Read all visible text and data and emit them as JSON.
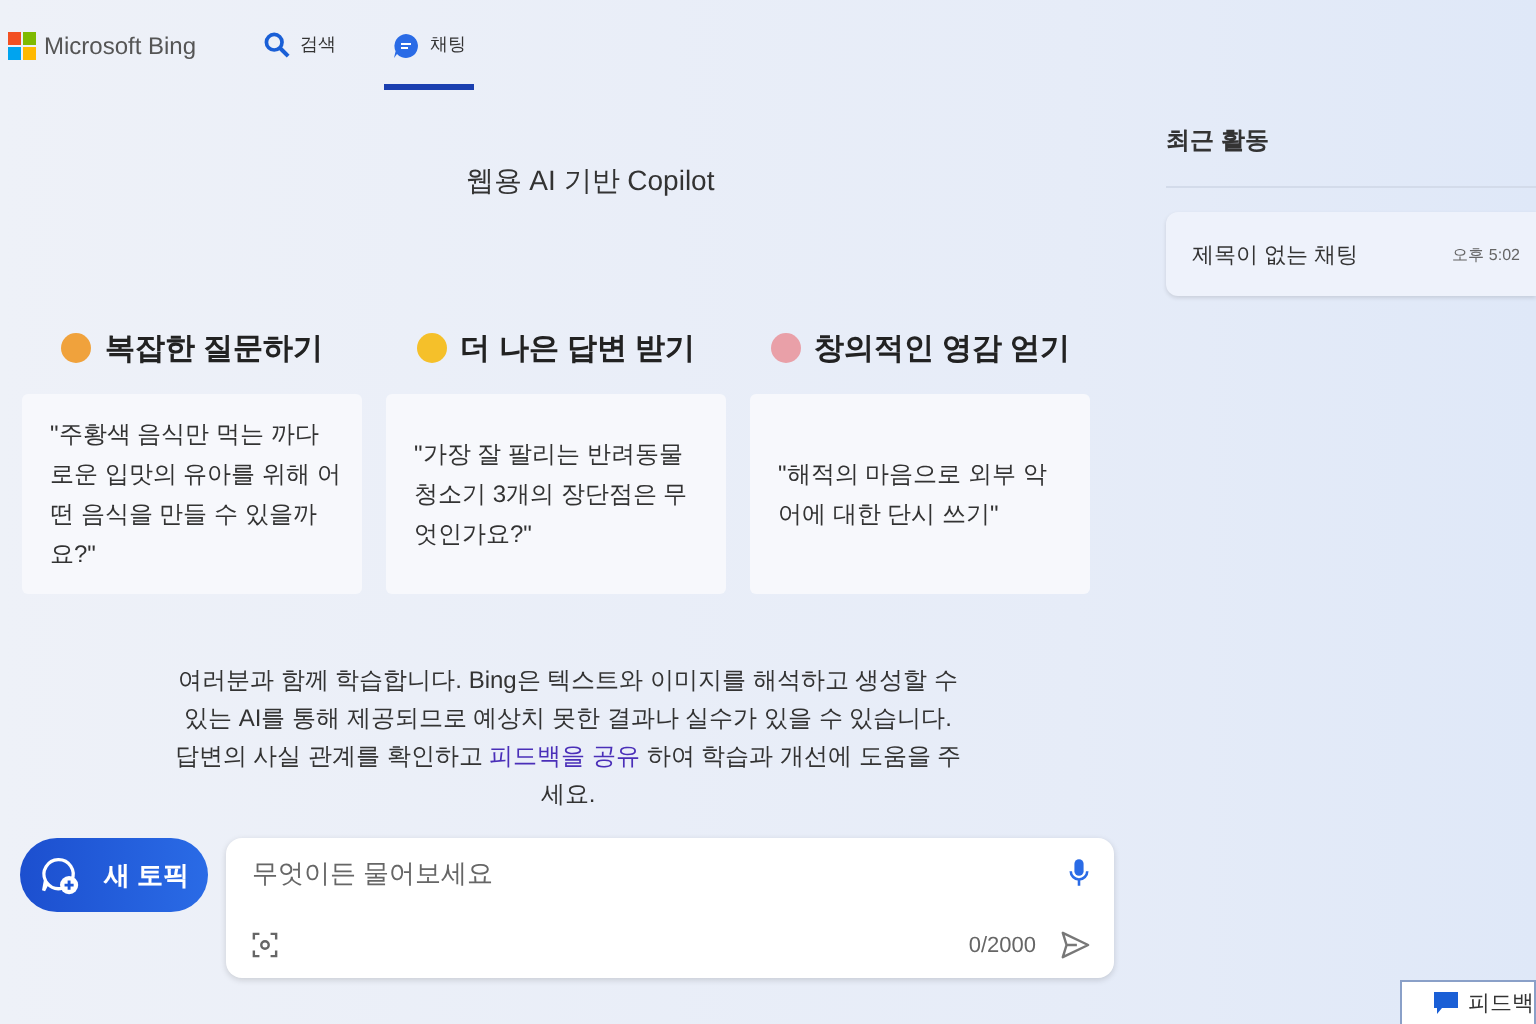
{
  "header": {
    "brand": "Microsoft Bing",
    "tabs": [
      {
        "label": "검색",
        "kind": "search",
        "selected": false
      },
      {
        "label": "채팅",
        "kind": "chat",
        "selected": true
      }
    ]
  },
  "subtitle": "웹용 AI 기반 Copilot",
  "categories": [
    {
      "title": "복잡한 질문하기",
      "color": "#f0a23c",
      "prompt": "\"주황색 음식만 먹는 까다로운 입맛의 유아를 위해 어떤 음식을 만들 수 있을까요?\""
    },
    {
      "title": "더 나은 답변 받기",
      "color": "#f5c02a",
      "prompt": "\"가장 잘 팔리는 반려동물 청소기 3개의 장단점은 무엇인가요?\""
    },
    {
      "title": "창의적인 영감 얻기",
      "color": "#e9a0a8",
      "prompt": "\"해적의 마음으로 외부 악어에 대한 단시 쓰기\""
    }
  ],
  "disclaimer": {
    "before": "여러분과 함께 학습합니다. Bing은 텍스트와 이미지를 해석하고 생성할 수 있는 AI를 통해 제공되므로 예상치 못한 결과나 실수가 있을 수 있습니다. 답변의 사실 관계를 확인하고 ",
    "link": "피드백을 공유",
    "after": " 하여 학습과 개선에 도움을 주세요."
  },
  "new_topic": "새 토픽",
  "composer": {
    "placeholder": "무엇이든 물어보세요",
    "counter": "0/2000"
  },
  "recent": {
    "title": "최근 활동",
    "items": [
      {
        "title": "제목이 없는 채팅",
        "time": "오후 5:02"
      }
    ]
  },
  "feedback_button": "피드백"
}
